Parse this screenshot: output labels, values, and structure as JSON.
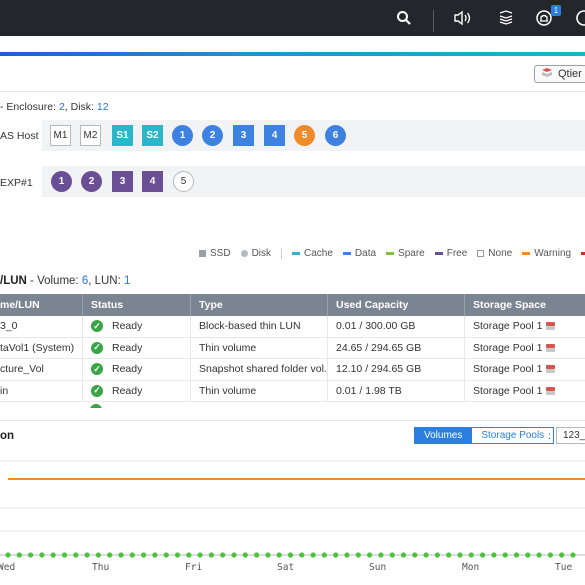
{
  "topbar": {
    "icons": [
      "search-icon",
      "volume-icon",
      "task-stack-icon",
      "notification-icon",
      "help-icon"
    ],
    "notification_count": "1"
  },
  "toolbar": {
    "qtier_label": "Qtier"
  },
  "enclosure": {
    "prefix": "- Enclosure: ",
    "enclosure_count": "2",
    "disk_prefix": ", Disk: ",
    "disk_count": "12"
  },
  "nas_row": {
    "label": "AS Host",
    "slots": [
      {
        "label": "M1",
        "kind": "sq-out"
      },
      {
        "label": "M2",
        "kind": "sq-out"
      },
      {
        "label": "S1",
        "kind": "sq-teal"
      },
      {
        "label": "S2",
        "kind": "sq-teal"
      },
      {
        "label": "1",
        "kind": "c-blue"
      },
      {
        "label": "2",
        "kind": "c-blue"
      },
      {
        "label": "3",
        "kind": "sq-blue"
      },
      {
        "label": "4",
        "kind": "sq-blue"
      },
      {
        "label": "5",
        "kind": "c-orange"
      },
      {
        "label": "6",
        "kind": "c-blue"
      }
    ]
  },
  "exp_row": {
    "label": "EXP#1",
    "slots": [
      {
        "label": "1",
        "kind": "c-purple"
      },
      {
        "label": "2",
        "kind": "c-purple"
      },
      {
        "label": "3",
        "kind": "sq-purple"
      },
      {
        "label": "4",
        "kind": "sq-purple"
      },
      {
        "label": "5",
        "kind": "c-out"
      }
    ]
  },
  "legend": {
    "ssd": "SSD",
    "disk": "Disk",
    "cache": "Cache",
    "data": "Data",
    "spare": "Spare",
    "free": "Free",
    "none": "None",
    "warning": "Warning",
    "colors": {
      "ssd": "#9aa0a6",
      "disk": "#b5b9bf",
      "cache": "#2bb6c9",
      "data": "#3d82e0",
      "spare": "#7dc13e",
      "free": "#6b4f95",
      "warning": "#f18b2a",
      "error": "#d62b2b"
    }
  },
  "volumes": {
    "title": "/LUN",
    "vol_prefix": " - Volume: ",
    "vol_count": "6",
    "lun_prefix": ", LUN: ",
    "lun_count": "1",
    "columns": [
      "me/LUN",
      "Status",
      "Type",
      "Used Capacity",
      "Storage Space"
    ],
    "rows": [
      {
        "name": "3_0",
        "status": "Ready",
        "type": "Block-based thin LUN",
        "used": "0.01 / 300.00 GB",
        "space": "Storage Pool 1"
      },
      {
        "name": "taVol1 (System)",
        "status": "Ready",
        "type": "Thin volume",
        "used": "24.65 / 294.65 GB",
        "space": "Storage Pool 1"
      },
      {
        "name": "cture_Vol",
        "status": "Ready",
        "type": "Snapshot shared folder vol...",
        "used": "12.10 / 294.65 GB",
        "space": "Storage Pool 1"
      },
      {
        "name": "in",
        "status": "Ready",
        "type": "Thin volume",
        "used": "0.01 / 1.98 TB",
        "space": "Storage Pool 1"
      }
    ]
  },
  "usage": {
    "title": "on",
    "tab_volumes": "Volumes",
    "tab_pools": "Storage Pools",
    "colon": ":",
    "select_value": "123_",
    "x_labels": [
      "Wed",
      "Thu",
      "Fri",
      "Sat",
      "Sun",
      "Mon",
      "Tue"
    ],
    "line_color": "#f18b2a",
    "dot_color": "#4cc33b"
  }
}
